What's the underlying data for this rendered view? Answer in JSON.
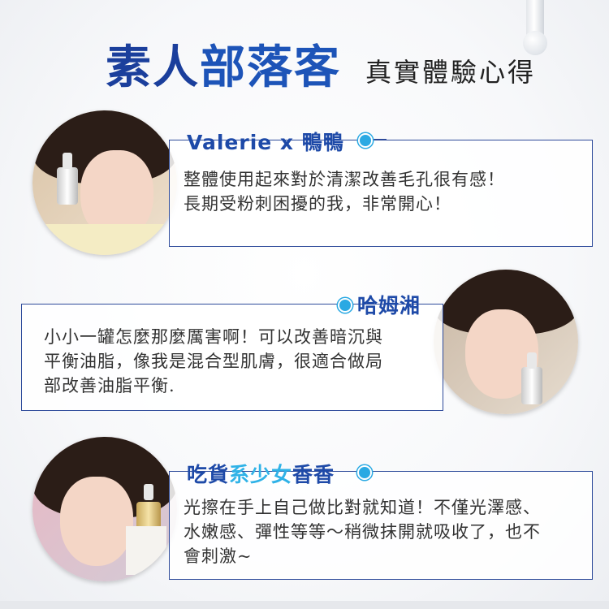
{
  "title": {
    "main_part1": "素人",
    "main_part2": "部落客",
    "subtitle": "真實體驗心得"
  },
  "reviews": [
    {
      "name_plain": "Valerie x 鴨鴨",
      "text": "整體使用起來對於清潔改善毛孔很有感！\n長期受粉刺困擾的我，非常開心！"
    },
    {
      "name_plain": "哈姆湘",
      "text": "小小一罐怎麼那麼厲害啊！可以改善暗沉與\n平衡油脂，像我是混合型肌膚，很適合做局\n部改善油脂平衡."
    },
    {
      "name_part1": "吃貨",
      "name_part2": "系少女",
      "name_part3": "香香",
      "text": "光擦在手上自己做比對就知道！不僅光澤感、\n水嫩感、彈性等等～稍微抹開就吸收了，也不\n會刺激~"
    }
  ],
  "colors": {
    "title_blue": "#1d54b8",
    "accent_cyan": "#2fb2e7",
    "border_navy": "#2d4a9a"
  }
}
